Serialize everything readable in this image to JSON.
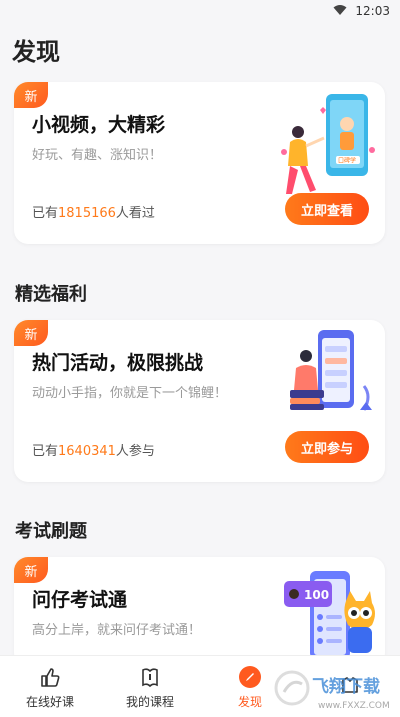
{
  "status_bar": {
    "time": "12:03",
    "icons": [
      "wifi-icon"
    ]
  },
  "page": {
    "title": "发现"
  },
  "cards": [
    {
      "badge": "新",
      "title": "小视频，大精彩",
      "subtitle": "好玩、有趣、涨知识！",
      "count_prefix": "已有",
      "count_value": "1815166",
      "count_suffix": "人看过",
      "button_label": "立即查看",
      "illustration_text": "口碑学"
    },
    {
      "badge": "新",
      "title": "热门活动，极限挑战",
      "subtitle": "动动小手指，你就是下一个锦鲤！",
      "count_prefix": "已有",
      "count_value": "1640341",
      "count_suffix": "人参与",
      "button_label": "立即参与"
    },
    {
      "badge": "新",
      "title": "问仔考试通",
      "subtitle": "高分上岸，就来问仔考试通！",
      "illustration_text": "100"
    }
  ],
  "sections": {
    "welfare_title": "精选福利",
    "exam_title": "考试刷题"
  },
  "bottom_nav": [
    {
      "label": "在线好课",
      "icon": "thumbs-up-icon",
      "active": false
    },
    {
      "label": "我的课程",
      "icon": "book-icon",
      "active": false
    },
    {
      "label": "发现",
      "icon": "compass-pen-icon",
      "active": true
    },
    {
      "label": "",
      "icon": "profile-icon",
      "active": false
    }
  ],
  "watermark": {
    "text": "飞翔下载",
    "url_text": "www.FXXZ.COM"
  },
  "colors": {
    "accent": "#ff5a1f",
    "accent_light": "#ff7a1a",
    "background": "#f6f6f8"
  }
}
